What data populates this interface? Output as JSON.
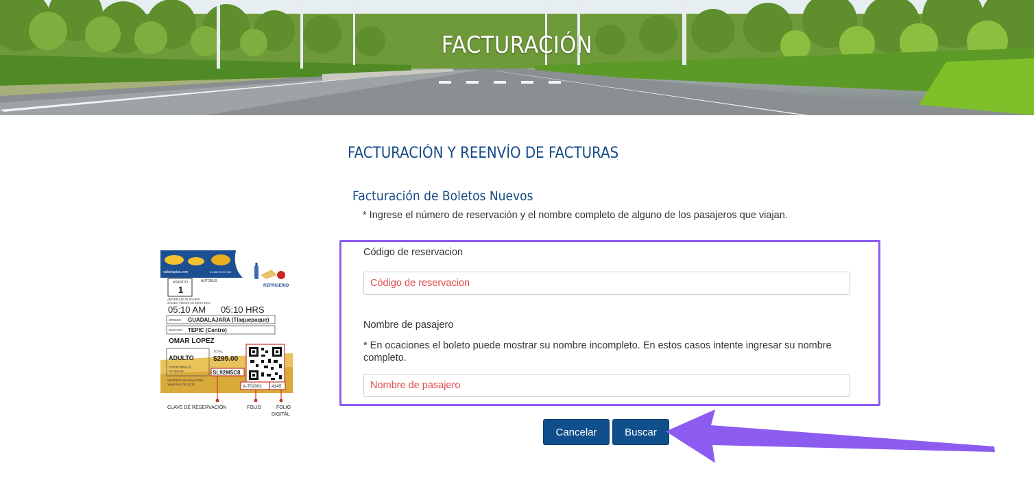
{
  "hero": {
    "title": "FACTURACIÓN"
  },
  "page": {
    "heading": "FACTURACIÓN Y REENVÍO DE FACTURAS",
    "section_title": "Facturación de Boletos Nuevos",
    "section_note": "* Ingrese el número de reservación y el nombre completo de alguno de los pasajeros que viajan."
  },
  "form": {
    "reservation": {
      "label": "Código de reservacion",
      "placeholder": "Código de reservacion",
      "value": ""
    },
    "passenger": {
      "label": "Nombre de pasajero",
      "note": "* En ocaciones el boleto puede mostrar su nombre incompleto. En estos casos intente ingresar su nombre completo.",
      "placeholder": "Nombre de pasajero",
      "value": ""
    }
  },
  "buttons": {
    "cancel": "Cancelar",
    "search": "Buscar"
  },
  "ticket": {
    "website": "vallartaplus.com",
    "phone": "01 800 00 00 000",
    "refreshment_label": "REFRIGERIO",
    "seat_label": "ASIENTO",
    "seat": "1",
    "bus_label": "AUTOBUS",
    "boarding_line": "ABORDAJE 05:00 HRS",
    "departure_line": "SALIDA Viernes 20 Enero 2017",
    "time1": "05:10 AM",
    "time2": "05:10 HRS",
    "origin_label": "ORIGEN",
    "origin": "GUADALAJARA (Tlaquepaque)",
    "destination_label": "DESTINO",
    "destination": "TEPIC (Centro)",
    "passenger_name": "OMAR LOPEZ",
    "passenger_type": "ADULTO",
    "total_label": "TOTAL",
    "total": "$295.00",
    "cost_line": "COSTO  $254.31",
    "tax_line": "IVA  $40.69",
    "reservation_code": "SL92M5C8",
    "validity_line": "VIGENCIA 20-enero-2018",
    "agent_line": "Yosef Ruiz   36 11:20",
    "folio": "A-702001",
    "digital_folio": "4145",
    "callout_reservation": "CLAVE DE RESERVACIÓN",
    "callout_folio": "FOLIO",
    "callout_digital_1": "FOLIO",
    "callout_digital_2": "DIGITAL"
  },
  "colors": {
    "heading": "#154a86",
    "button": "#0f4f8c",
    "highlight": "#8c5cf0",
    "placeholder": "#e0494b"
  },
  "icons": [
    "annotation-arrow-icon",
    "water-bottle-icon",
    "sandwich-icon",
    "apple-icon",
    "qr-code-icon"
  ]
}
